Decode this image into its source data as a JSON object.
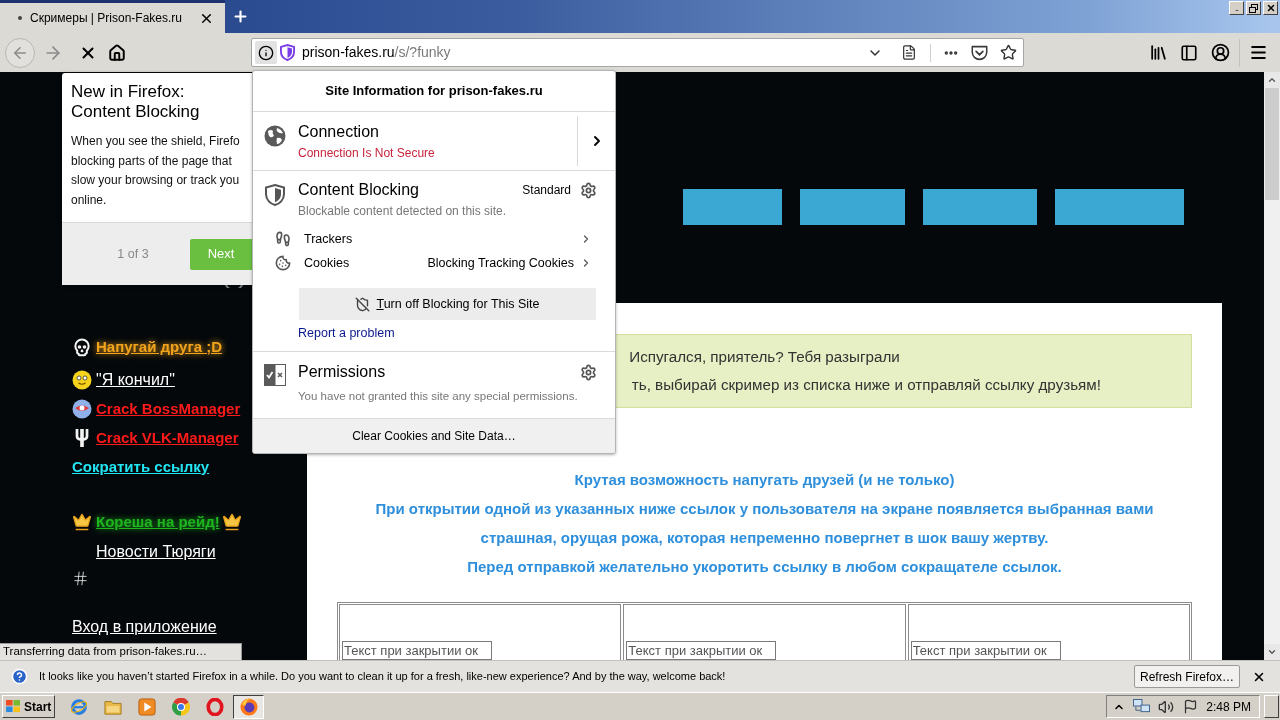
{
  "tab_bar": {
    "tabs": [
      {
        "title": "Скримеры | Prison-Fakes.ru",
        "selected": true
      }
    ]
  },
  "address_bar": {
    "host": "prison-fakes.ru",
    "path": "/s/?funky"
  },
  "whats_new_panel": {
    "title_lines": [
      "New in Firefox:",
      "Content Blocking"
    ],
    "body_lines": [
      "When you see the shield, Firefo",
      "blocking parts of the page that",
      "slow your browsing or track you",
      "online."
    ],
    "step": "1 of 3",
    "next_button": "Next"
  },
  "site_information": {
    "title": "Site Information for prison-fakes.ru",
    "connection": {
      "label": "Connection",
      "status": "Connection Is Not Secure"
    },
    "content_blocking": {
      "label": "Content Blocking",
      "mode": "Standard",
      "description": "Blockable content detected on this site.",
      "items": [
        {
          "kind": "trackers",
          "label": "Trackers"
        },
        {
          "kind": "cookies",
          "label": "Cookies",
          "value": "Blocking Tracking Cookies"
        }
      ],
      "toggle_button": "Turn off Blocking for This Site",
      "report_link": "Report a problem"
    },
    "permissions": {
      "label": "Permissions",
      "description": "You have not granted this site any special permissions."
    },
    "clear_button": "Clear Cookies and Site Data…"
  },
  "page": {
    "sidebar_links": [
      {
        "kind": "glow",
        "text": "Напугай друга ;D",
        "color": "#f2a31c"
      },
      {
        "kind": "plain",
        "text": "\"Я кончил\"",
        "color": "#ffffff"
      },
      {
        "kind": "bold",
        "text": "Crack BossManager",
        "color": "#ff1a1a"
      },
      {
        "kind": "bold",
        "text": "Crack VLK-Manager",
        "color": "#ff1a1a"
      },
      {
        "kind": "bold",
        "text": "Сократить ссылку",
        "color": "#22e4f2"
      },
      {
        "kind": "glow",
        "text": "Кореша на рейд!",
        "color": "#1fb51f"
      },
      {
        "kind": "plain",
        "text": "Новости Тюряги",
        "color": "#ffffff"
      },
      {
        "kind": "plain",
        "text": "Вход в приложение",
        "color": "#ffffff"
      }
    ],
    "notice_lines": [
      "Испугался, приятель? Тебя разыграли",
      "ть, выбирай скример из списка ниже и отправляй ссылку друзьям!"
    ],
    "intro": {
      "heading": "Крутая возможность напугать друзей (и не только)",
      "paragraph_lines": [
        "При открытии одной из указанных ниже ссылок у пользователя на экране появляется выбранная вами",
        "страшная, орущая рожа, которая непременно повергнет в шок вашу жертву."
      ],
      "note": "Перед отправкой желательно укоротить ссылку в любом сокращателе ссылок."
    },
    "scare_table": {
      "cells": [
        {
          "placeholder": "Текст при закрытии ок"
        },
        {
          "placeholder": "Текст при закрытии ок"
        },
        {
          "placeholder": "Текст при закрытии ок"
        }
      ]
    }
  },
  "status_text": "Transferring data from prison-fakes.ru…",
  "notification": {
    "message": "It looks like you haven’t started Firefox in a while. Do you want to clean it up for a fresh, like-new experience? And by the way, welcome back!",
    "button": "Refresh Firefox…"
  },
  "taskbar": {
    "start": "Start",
    "apps": [
      {
        "selected": false
      },
      {
        "selected": false
      },
      {
        "selected": false
      },
      {
        "selected": false
      },
      {
        "selected": false
      },
      {
        "selected": true
      }
    ],
    "clock": "2:48 PM"
  }
}
